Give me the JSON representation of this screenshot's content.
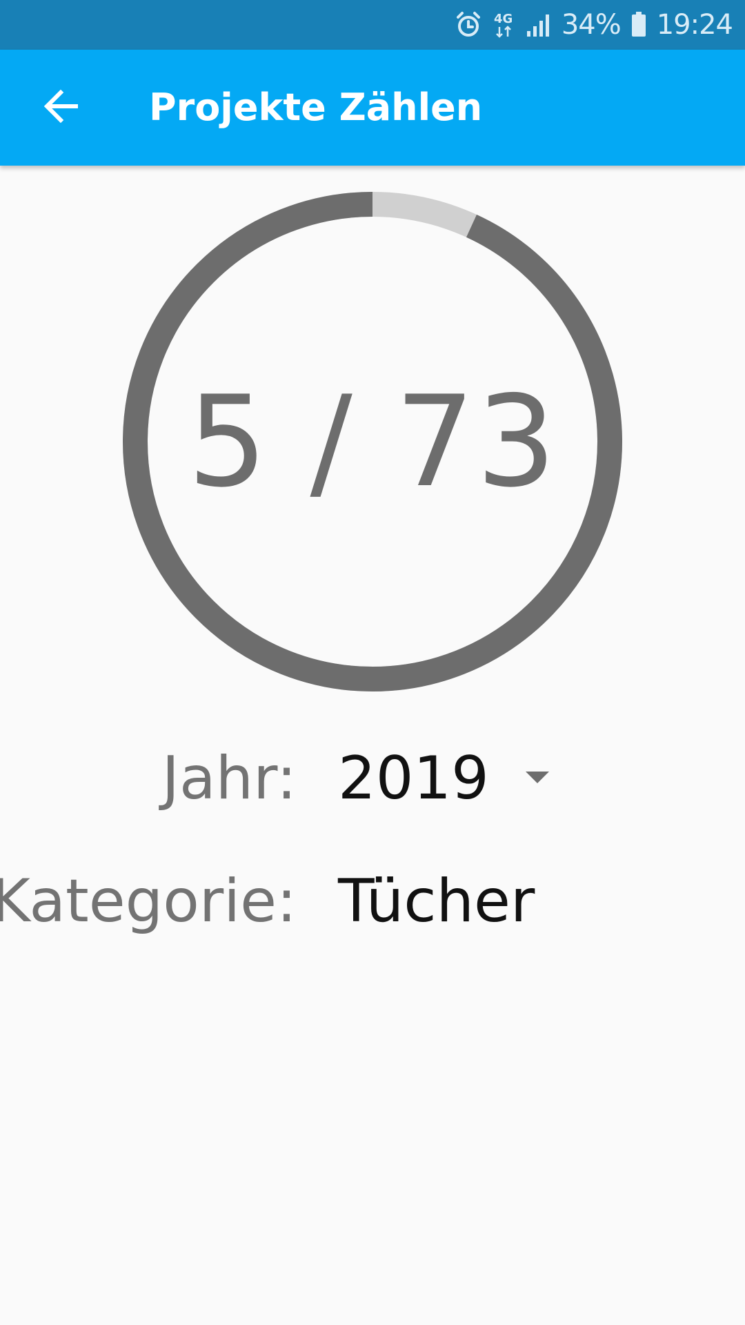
{
  "status_bar": {
    "icons": [
      "alarm-icon",
      "4g-icon",
      "signal-icon",
      "battery-icon"
    ],
    "network": "4G",
    "battery": "34%",
    "time": "19:24"
  },
  "app_bar": {
    "back_icon": "arrow-back-icon",
    "title": "Projekte Zählen"
  },
  "progress": {
    "current": 5,
    "total": 73,
    "display": "5 / 73",
    "fill_color": "#6d6d6d",
    "remaining_color": "#d0d0d0"
  },
  "form": {
    "year": {
      "label": "Jahr:",
      "value": "2019",
      "icon": "dropdown-arrow-icon"
    },
    "category": {
      "label": "Kategorie:",
      "value": "Tücher"
    }
  },
  "colors": {
    "status_bar": "#1880b6",
    "app_bar": "#04a9f4",
    "background": "#fafafa"
  }
}
